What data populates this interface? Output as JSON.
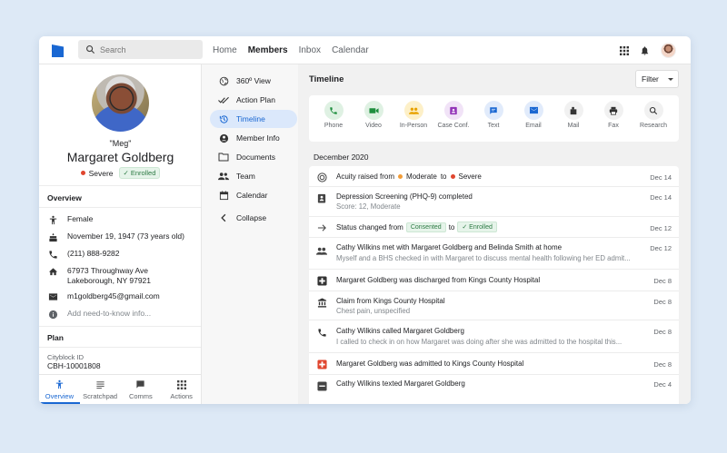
{
  "topbar": {
    "search_placeholder": "Search",
    "nav": [
      "Home",
      "Members",
      "Inbox",
      "Calendar"
    ],
    "active_nav": "Members"
  },
  "profile": {
    "nickname": "\"Meg\"",
    "name": "Margaret Goldberg",
    "severity": "Severe",
    "status_badge": "✓ Enrolled",
    "overview_title": "Overview",
    "gender": "Female",
    "dob": "November 19, 1947 (73 years old)",
    "phone": "(211) 888-9282",
    "address_line1": "67973 Throughway Ave",
    "address_line2": "Lakeborough, NY 97921",
    "email": "m1goldberg45@gmail.com",
    "need_to_know_placeholder": "Add need-to-know info...",
    "plan_title": "Plan",
    "cityblock_label": "Cityblock ID",
    "cityblock_id": "CBH-10001808"
  },
  "bottom_tabs": [
    "Overview",
    "Scratchpad",
    "Comms",
    "Actions"
  ],
  "subnav": [
    "360º View",
    "Action Plan",
    "Timeline",
    "Member Info",
    "Documents",
    "Team",
    "Calendar",
    "Collapse"
  ],
  "main": {
    "title": "Timeline",
    "filter_label": "Filter",
    "actions": [
      "Phone",
      "Video",
      "In-Person",
      "Case Conf.",
      "Text",
      "Email",
      "Mail",
      "Fax",
      "Research"
    ],
    "month": "December 2020"
  },
  "timeline": [
    {
      "title_parts": [
        "Acuity raised from",
        "Moderate",
        "to",
        "Severe"
      ],
      "date": "Dec 14"
    },
    {
      "title": "Depression Screening (PHQ-9) completed",
      "sub": "Score: 12, Moderate",
      "date": "Dec 14"
    },
    {
      "title_parts": [
        "Status changed from",
        "Consented",
        "to",
        "✓ Enrolled"
      ],
      "date": "Dec 12"
    },
    {
      "title": "Cathy Wilkins met with Margaret Goldberg and Belinda Smith at home",
      "sub": "Myself and a BHS checked in with Margaret to discuss mental health following her ED admit...",
      "date": "Dec 12"
    },
    {
      "title": "Margaret Goldberg was discharged from Kings County Hospital",
      "date": "Dec 8"
    },
    {
      "title": "Claim from Kings County Hospital",
      "sub": "Chest pain, unspecified",
      "date": "Dec 8"
    },
    {
      "title": "Cathy Wilkins called Margaret Goldberg",
      "sub": "I called to check in on how Margaret was doing after she was admitted to the hospital this...",
      "date": "Dec 8"
    },
    {
      "title": "Margaret Goldberg was admitted to Kings County Hospital",
      "date": "Dec 8"
    },
    {
      "title": "Cathy Wilkins texted Margaret Goldberg",
      "date": "Dec 4"
    }
  ],
  "colors": {
    "accent": "#1967d2",
    "severe": "#e0462f",
    "moderate": "#f29d38",
    "enrolled_bg": "#e6f4ea",
    "enrolled_fg": "#2c7a43"
  }
}
